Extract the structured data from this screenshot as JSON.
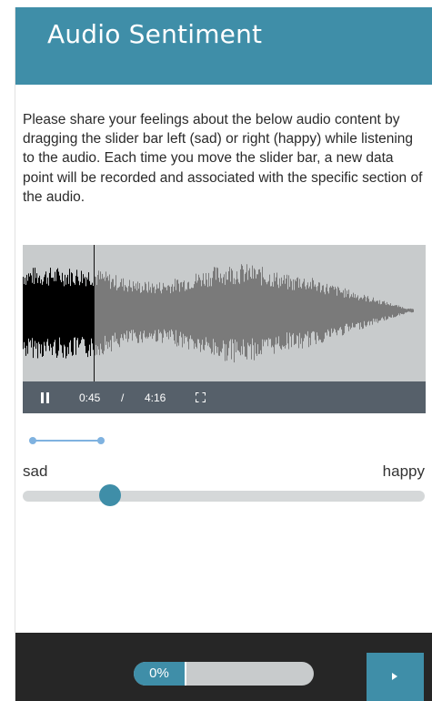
{
  "header": {
    "title": "Audio Sentiment"
  },
  "instructions": "Please share your feelings about the below audio content by dragging the slider bar left (sad) or right (happy) while listening to the audio. Each time you move the slider bar, a new data point will be recorded and associated with the specific section of the audio.",
  "player": {
    "current_time": "0:45",
    "separator": "/",
    "total_time": "4:16",
    "played_fraction": 0.176,
    "pause_icon": "pause-icon",
    "fullscreen_icon": "fullscreen-icon",
    "colors": {
      "played": "#000000",
      "unplayed": "#7a7a7a",
      "background": "#c8cbcc",
      "controls": "#56606a"
    }
  },
  "sentiment": {
    "left_label": "sad",
    "right_label": "happy",
    "slider_value": 0.22
  },
  "footer": {
    "progress_label": "0%",
    "progress_value": 0,
    "next_icon": "chevron-right-icon"
  },
  "colors": {
    "accent": "#3f8ea8",
    "footer_bg": "#262626",
    "recording_line": "#7fb2e0"
  }
}
